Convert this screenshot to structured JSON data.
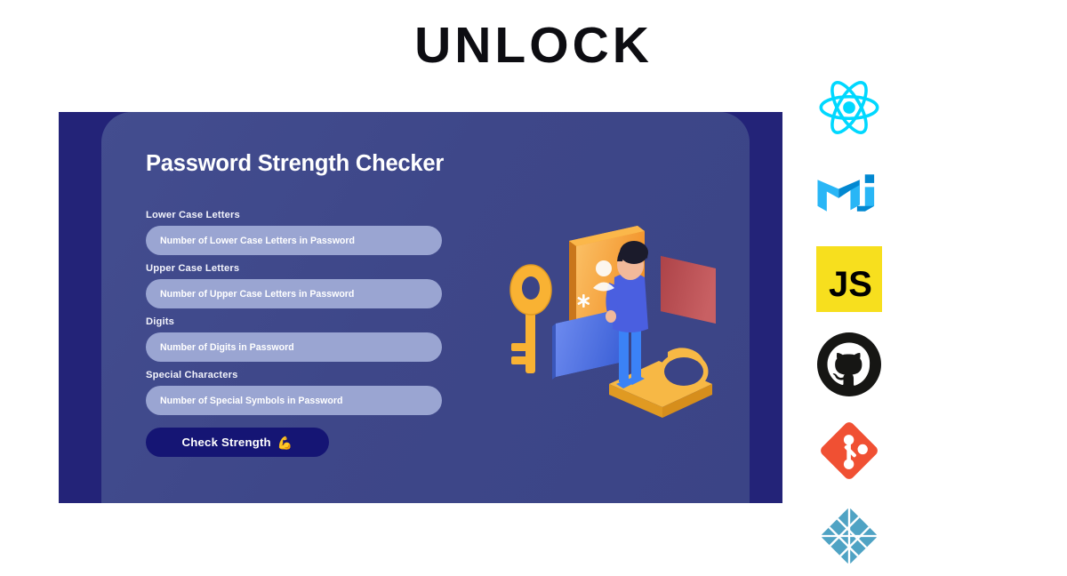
{
  "page": {
    "title": "UNLOCK",
    "background_color": "#ffffff",
    "title_color": "#0d0d12"
  },
  "app": {
    "window_background": "#232378",
    "card_background": "#3e4789",
    "card": {
      "heading": "Password Strength Checker",
      "form": {
        "fields": [
          {
            "label": "Lower Case Letters",
            "placeholder": "Number of Lower Case Letters in Password",
            "value": "",
            "name": "lower-case-letters"
          },
          {
            "label": "Upper Case Letters",
            "placeholder": "Number of Upper Case Letters in Password",
            "value": "",
            "name": "upper-case-letters"
          },
          {
            "label": "Digits",
            "placeholder": "Number of Digits in Password",
            "value": "",
            "name": "digits"
          },
          {
            "label": "Special Characters",
            "placeholder": "Number of Special Symbols in Password",
            "value": "",
            "name": "special-characters"
          }
        ],
        "submit": {
          "label": "Check Strength",
          "emoji": "💪",
          "background_color": "#151574",
          "text_color": "#ffffff"
        },
        "input_background": "#9aa5d2",
        "input_text_color": "#ffffff"
      }
    },
    "illustration": {
      "name": "isometric-security-illustration",
      "description": "Isometric scene: golden key, orange, blue and red panels, person in blue standing on a golden padlock",
      "colors": {
        "key": "#f9b233",
        "panel_orange": "#f6a02a",
        "panel_blue": "#4f74e3",
        "panel_red": "#b94a4e",
        "padlock": "#f7b845",
        "person_shirt": "#4a5fe0",
        "person_pants": "#3b82f6",
        "person_hair": "#1b1b2b",
        "person_skin": "#f2b99a"
      }
    }
  },
  "tech_stack": {
    "items": [
      {
        "name": "react-icon",
        "label": "React",
        "color": "#00d8ff"
      },
      {
        "name": "material-ui-icon",
        "label": "Material UI",
        "color": "#0288d1",
        "color_light": "#29b6f6"
      },
      {
        "name": "javascript-icon",
        "label": "JavaScript",
        "color": "#f7df1e",
        "text_color": "#000000",
        "text": "JS"
      },
      {
        "name": "github-icon",
        "label": "GitHub",
        "color": "#161614"
      },
      {
        "name": "git-icon",
        "label": "Git",
        "color": "#f05033"
      },
      {
        "name": "netlify-icon",
        "label": "Netlify",
        "color": "#4fa3c4"
      }
    ]
  }
}
